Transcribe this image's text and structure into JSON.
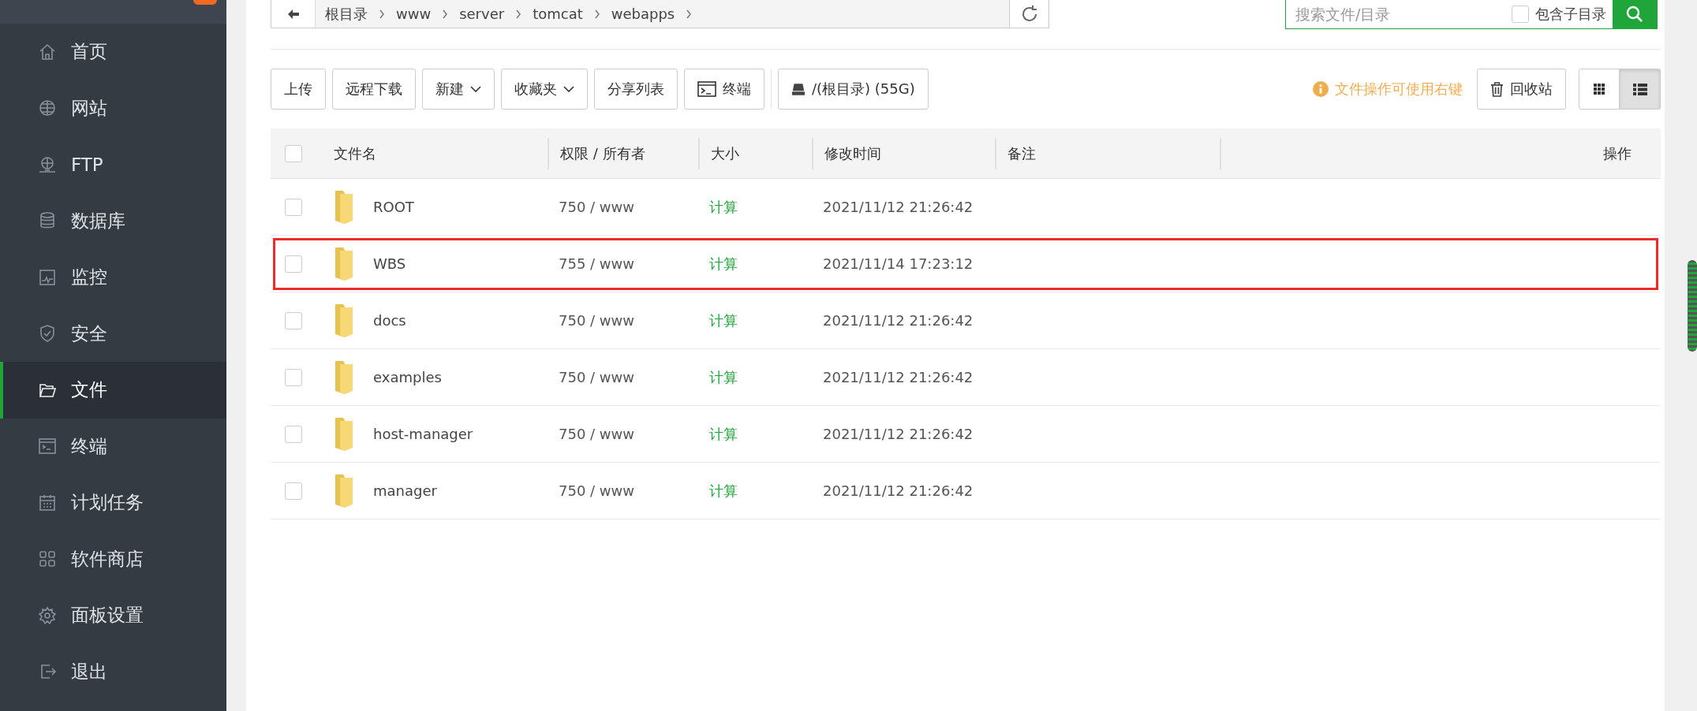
{
  "sidebar": {
    "items": [
      {
        "label": "首页",
        "kind": "home",
        "selected": false
      },
      {
        "label": "网站",
        "kind": "globe",
        "selected": false
      },
      {
        "label": "FTP",
        "kind": "ftp",
        "selected": false
      },
      {
        "label": "数据库",
        "kind": "database",
        "selected": false
      },
      {
        "label": "监控",
        "kind": "monitor",
        "selected": false
      },
      {
        "label": "安全",
        "kind": "shield",
        "selected": false
      },
      {
        "label": "文件",
        "kind": "folder",
        "selected": true
      },
      {
        "label": "终端",
        "kind": "terminal",
        "selected": false
      },
      {
        "label": "计划任务",
        "kind": "calendar",
        "selected": false
      },
      {
        "label": "软件商店",
        "kind": "grid",
        "selected": false
      },
      {
        "label": "面板设置",
        "kind": "gear",
        "selected": false
      },
      {
        "label": "退出",
        "kind": "exit",
        "selected": false
      }
    ]
  },
  "breadcrumb": [
    "根目录",
    "www",
    "server",
    "tomcat",
    "webapps"
  ],
  "search": {
    "placeholder": "搜索文件/目录",
    "include_subdirs": {
      "label": "包含子目录",
      "checked": false
    }
  },
  "toolbar": [
    {
      "label": "上传",
      "kind": "plain"
    },
    {
      "label": "远程下载",
      "kind": "plain"
    },
    {
      "label": "新建",
      "kind": "dropdown"
    },
    {
      "label": "收藏夹",
      "kind": "dropdown"
    },
    {
      "label": "分享列表",
      "kind": "plain"
    },
    {
      "label": "终端",
      "kind": "terminal"
    },
    {
      "label": "/(根目录) (55G)",
      "kind": "disk"
    }
  ],
  "hint": "文件操作可使用右键",
  "recycle_bin": "回收站",
  "view_modes": [
    {
      "kind": "grid",
      "selected": false
    },
    {
      "kind": "list",
      "selected": true
    }
  ],
  "table": {
    "all_checked": false,
    "columns": [
      "文件名",
      "权限 / 所有者",
      "大小",
      "修改时间",
      "备注",
      "操作"
    ],
    "rows": [
      {
        "name": "ROOT",
        "permissions": "750 / www",
        "size": "计算",
        "modified": "2021/11/12 21:26:42",
        "checked": false,
        "highlighted": false
      },
      {
        "name": "WBS",
        "permissions": "755 / www",
        "size": "计算",
        "modified": "2021/11/14 17:23:12",
        "checked": false,
        "highlighted": true
      },
      {
        "name": "docs",
        "permissions": "750 / www",
        "size": "计算",
        "modified": "2021/11/12 21:26:42",
        "checked": false,
        "highlighted": false
      },
      {
        "name": "examples",
        "permissions": "750 / www",
        "size": "计算",
        "modified": "2021/11/12 21:26:42",
        "checked": false,
        "highlighted": false
      },
      {
        "name": "host-manager",
        "permissions": "750 / www",
        "size": "计算",
        "modified": "2021/11/12 21:26:42",
        "checked": false,
        "highlighted": false
      },
      {
        "name": "manager",
        "permissions": "750 / www",
        "size": "计算",
        "modified": "2021/11/12 21:26:42",
        "checked": false,
        "highlighted": false
      }
    ]
  }
}
